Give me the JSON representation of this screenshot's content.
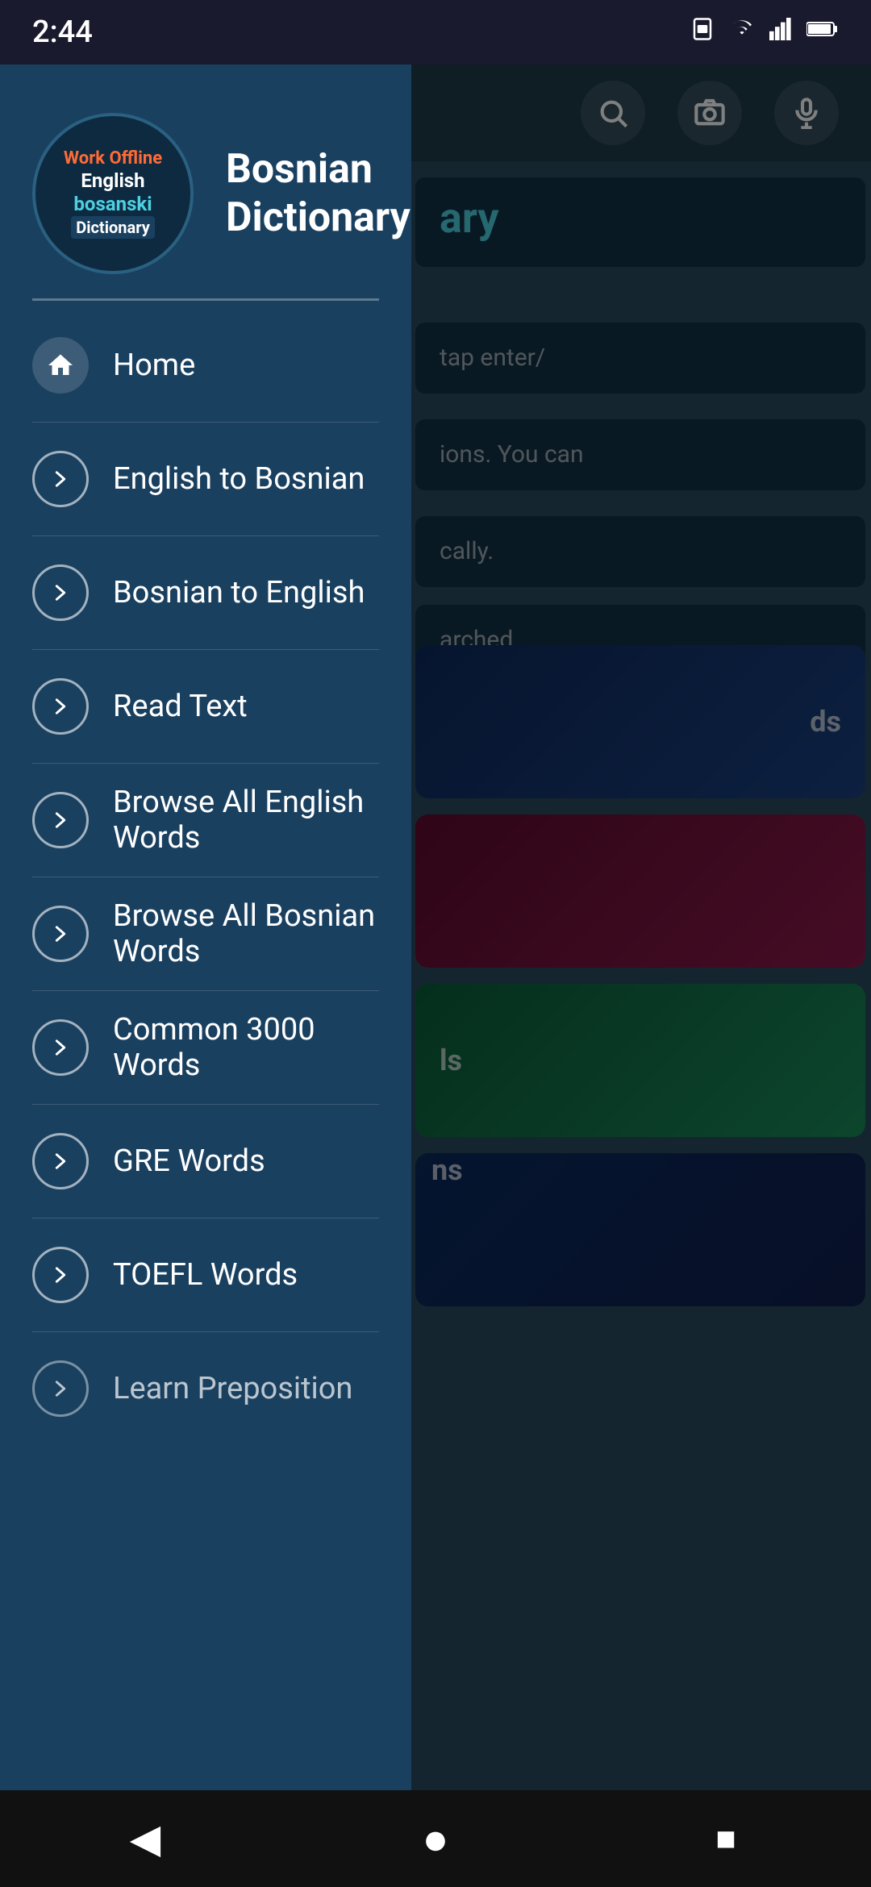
{
  "statusBar": {
    "time": "2:44",
    "icons": [
      "sim",
      "wifi",
      "battery"
    ]
  },
  "app": {
    "logoLine1": "Work Offline",
    "logoLine2": "English",
    "logoLine3": "bosanski",
    "logoLine4": "Dictionary",
    "title": "Bosnian Dictionary"
  },
  "actionBar": {
    "searchIcon": "search",
    "cameraIcon": "camera",
    "micIcon": "mic"
  },
  "drawer": {
    "menuItems": [
      {
        "id": "home",
        "label": "Home",
        "iconType": "home"
      },
      {
        "id": "english-to-bosnian",
        "label": "English to Bosnian",
        "iconType": "chevron"
      },
      {
        "id": "bosnian-to-english",
        "label": "Bosnian to English",
        "iconType": "chevron"
      },
      {
        "id": "read-text",
        "label": "Read Text",
        "iconType": "chevron"
      },
      {
        "id": "browse-all-english",
        "label": "Browse All English Words",
        "iconType": "chevron"
      },
      {
        "id": "browse-all-bosnian",
        "label": "Browse All Bosnian Words",
        "iconType": "chevron"
      },
      {
        "id": "common-3000",
        "label": "Common 3000 Words",
        "iconType": "chevron"
      },
      {
        "id": "gre-words",
        "label": "GRE Words",
        "iconType": "chevron"
      },
      {
        "id": "toefl-words",
        "label": "TOEFL Words",
        "iconType": "chevron"
      },
      {
        "id": "learn-preposition",
        "label": "Learn Preposition",
        "iconType": "chevron"
      }
    ]
  },
  "rightPanel": {
    "cardText1": "ary",
    "bodyText1": "tap enter/",
    "bodyText2": "ions. You can",
    "bodyText3": "cally.",
    "bodyText4": "arched.",
    "imgText1": "ds",
    "imgText3": "ls",
    "imgText4": "ns"
  },
  "navBar": {
    "backIcon": "◀",
    "homeIcon": "●",
    "squareIcon": "■"
  }
}
